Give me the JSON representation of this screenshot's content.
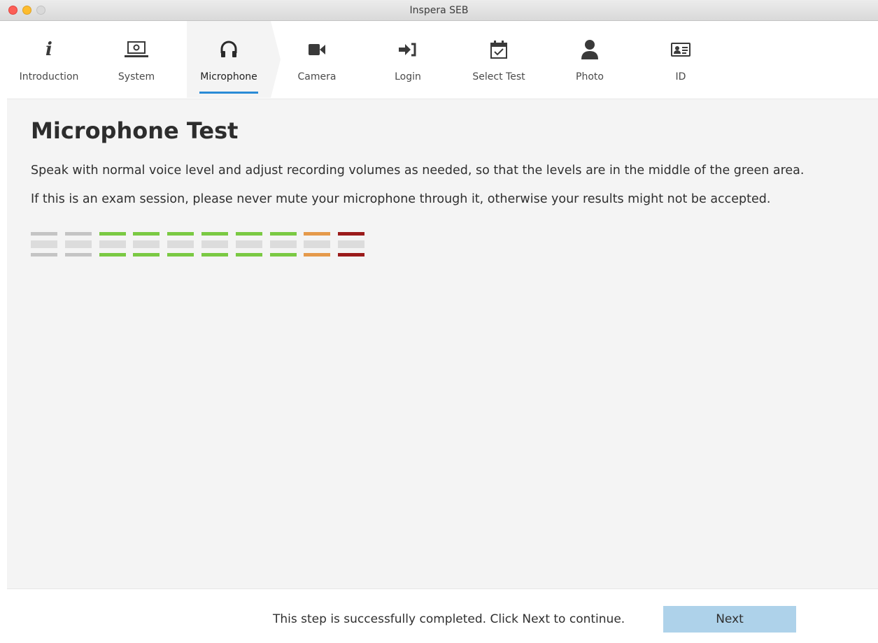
{
  "window": {
    "title": "Inspera SEB"
  },
  "steps": [
    {
      "label": "Introduction",
      "icon": "info-icon",
      "active": false
    },
    {
      "label": "System",
      "icon": "laptop-gear-icon",
      "active": false
    },
    {
      "label": "Microphone",
      "icon": "headphones-icon",
      "active": true
    },
    {
      "label": "Camera",
      "icon": "video-camera-icon",
      "active": false
    },
    {
      "label": "Login",
      "icon": "sign-in-icon",
      "active": false
    },
    {
      "label": "Select Test",
      "icon": "calendar-check-icon",
      "active": false
    },
    {
      "label": "Photo",
      "icon": "user-icon",
      "active": false
    },
    {
      "label": "ID",
      "icon": "id-card-icon",
      "active": false
    }
  ],
  "main": {
    "heading": "Microphone Test",
    "instruction": "Speak with normal voice level and adjust recording volumes as needed, so that the levels are in the middle of the green area.",
    "warning": "If this is an exam session, please never mute your microphone through it, otherwise your results might not be accepted."
  },
  "meter": {
    "segments": [
      "gray",
      "gray",
      "green",
      "green",
      "green",
      "green",
      "green",
      "green",
      "orange",
      "red"
    ],
    "colors": {
      "gray": "#c4c4c4",
      "green": "#7ac943",
      "orange": "#e59a4b",
      "red": "#9b1b1b",
      "accent": "#2a8bd6",
      "button": "#aed2ea"
    }
  },
  "footer": {
    "status": "This step is successfully completed. Click Next to continue.",
    "next_label": "Next"
  }
}
